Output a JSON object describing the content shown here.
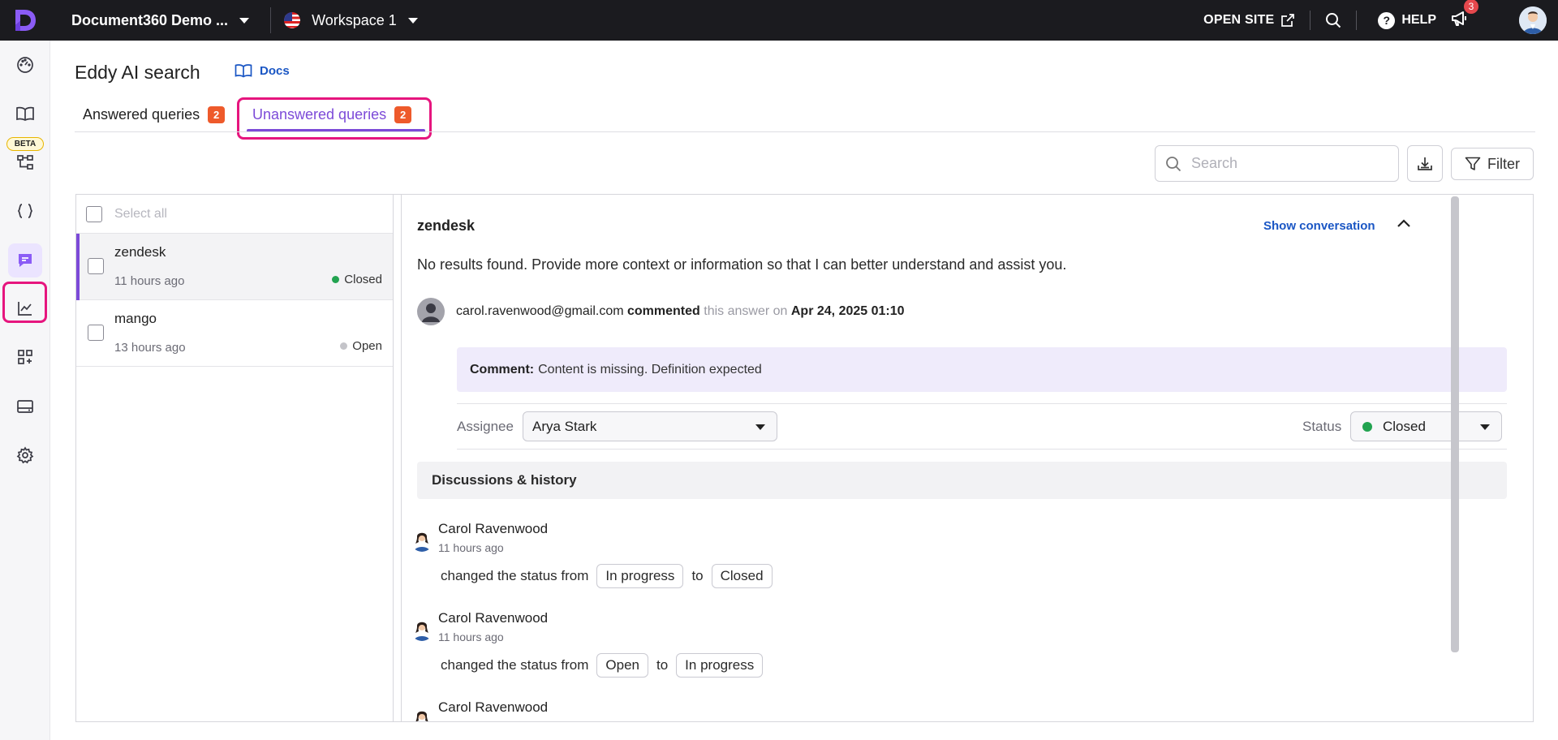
{
  "topbar": {
    "project_name": "Document360 Demo ...",
    "workspace": "Workspace 1",
    "open_site": "OPEN SITE",
    "help": "HELP",
    "notification_count": "3"
  },
  "leftnav": {
    "beta_label": "BETA",
    "icons": [
      "dashboard-icon",
      "documentation-icon",
      "workflow-icon",
      "api-icon",
      "eddy-ai-icon",
      "analytics-icon",
      "integrations-icon",
      "widgets-icon",
      "settings-icon"
    ],
    "active": "eddy-ai-icon"
  },
  "header": {
    "title": "Eddy AI search",
    "docs_link": "Docs"
  },
  "tabs": [
    {
      "label": "Answered queries",
      "count": "2"
    },
    {
      "label": "Unanswered queries",
      "count": "2",
      "active": true
    }
  ],
  "toolbar": {
    "search_placeholder": "Search",
    "filter_label": "Filter"
  },
  "list": {
    "select_all": "Select all",
    "items": [
      {
        "name": "zendesk",
        "time": "11 hours ago",
        "status": "Closed",
        "status_color": "#22a350",
        "selected": true
      },
      {
        "name": "mango",
        "time": "13 hours ago",
        "status": "Open",
        "status_color": "#c4c4c9",
        "selected": false
      }
    ]
  },
  "detail": {
    "title": "zendesk",
    "show_conversation": "Show conversation",
    "answer": "No results found. Provide more context or information so that I can better understand and assist you.",
    "comment_user": "carol.ravenwood@gmail.com",
    "commented": "commented",
    "this_answer_on": "this answer on",
    "comment_date": "Apr 24, 2025 01:10",
    "comment_label": "Comment:",
    "comment_text": "Content is missing. Definition expected",
    "assignee_label": "Assignee",
    "assignee_value": "Arya Stark",
    "status_label": "Status",
    "status_value": "Closed",
    "status_color": "#22a350",
    "discussions_title": "Discussions & history",
    "history": [
      {
        "user": "Carol Ravenwood",
        "time": "11 hours ago",
        "action": "changed the status from",
        "from": "In progress",
        "to_word": "to",
        "to": "Closed"
      },
      {
        "user": "Carol Ravenwood",
        "time": "11 hours ago",
        "action": "changed the status from",
        "from": "Open",
        "to_word": "to",
        "to": "In progress"
      },
      {
        "user": "Carol Ravenwood"
      }
    ]
  },
  "colors": {
    "accent": "#7c4ad8",
    "highlight": "#e6157e",
    "badge": "#ee5a2b",
    "link": "#1a56c4"
  }
}
